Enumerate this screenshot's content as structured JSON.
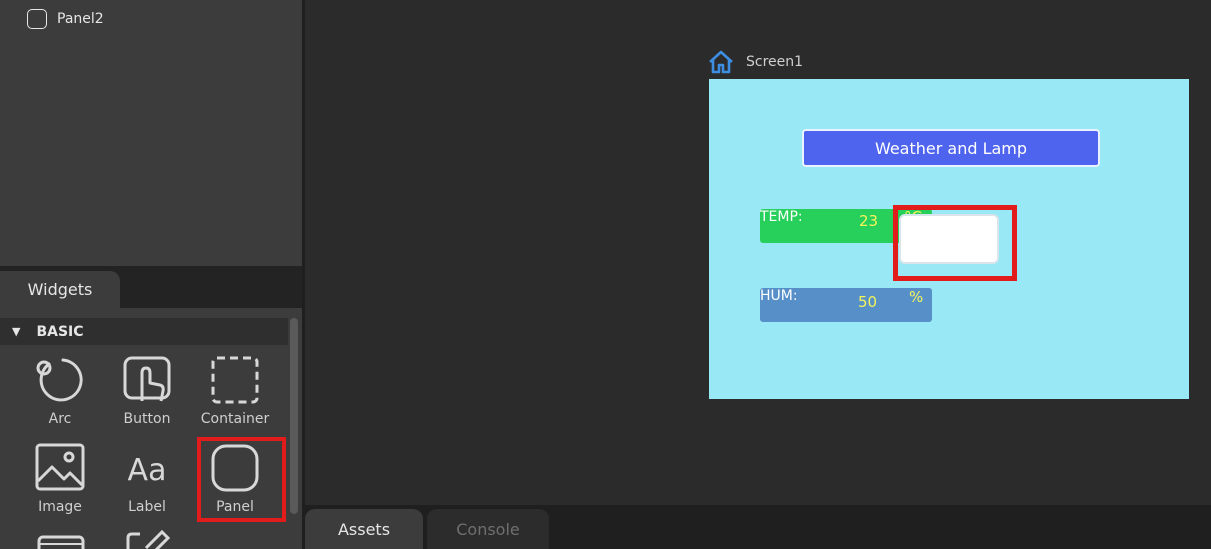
{
  "hierarchy": {
    "items": [
      {
        "label": "Panel2"
      }
    ]
  },
  "widgets": {
    "tab_label": "Widgets",
    "category": "BASIC",
    "items": [
      {
        "label": "Arc",
        "icon": "arc-icon"
      },
      {
        "label": "Button",
        "icon": "button-icon"
      },
      {
        "label": "Container",
        "icon": "container-icon"
      },
      {
        "label": "Image",
        "icon": "image-icon"
      },
      {
        "label": "Label",
        "icon": "label-icon"
      },
      {
        "label": "Panel",
        "icon": "panel-icon"
      }
    ],
    "selected": "Panel"
  },
  "bottom_tabs": [
    {
      "label": "Assets"
    },
    {
      "label": "Console"
    }
  ],
  "screen": {
    "name": "Screen1",
    "background": "#99e8f5",
    "title_button": "Weather and Lamp",
    "temp": {
      "label": "TEMP:",
      "value": "23",
      "unit": "°C"
    },
    "hum": {
      "label": "HUM:",
      "value": "50",
      "unit": "%"
    }
  },
  "colors": {
    "accent_red": "#e21b1b",
    "title_blue": "#4e63ee",
    "temp_green": "#27cf5b",
    "hum_blue": "#5790c8",
    "value_yellow": "#f4f45a"
  }
}
